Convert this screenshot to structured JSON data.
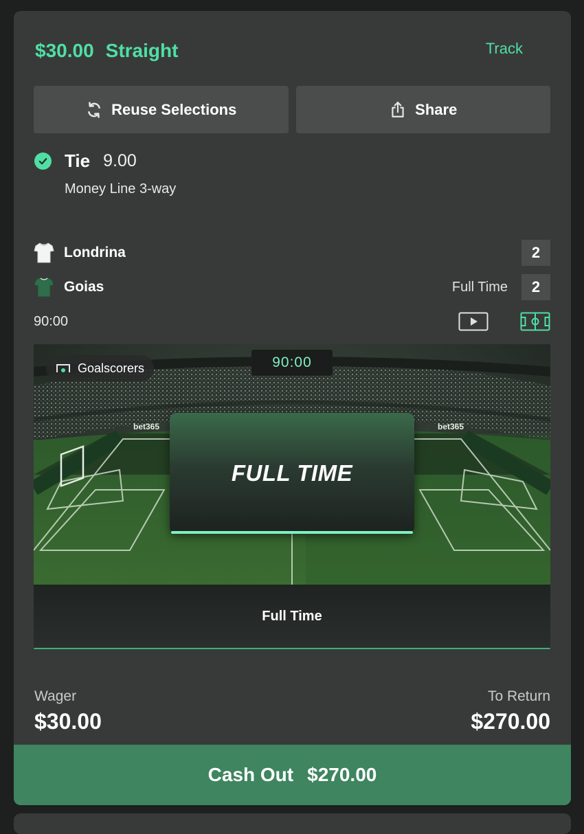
{
  "bet": {
    "stake": "$30.00",
    "type": "Straight",
    "track_label": "Track"
  },
  "actions": {
    "reuse_label": "Reuse Selections",
    "share_label": "Share"
  },
  "selection": {
    "name": "Tie",
    "odds": "9.00",
    "market": "Money Line 3-way",
    "status": "won"
  },
  "match": {
    "home": {
      "name": "Londrina",
      "score": "2"
    },
    "away": {
      "name": "Goias",
      "score": "2"
    },
    "status": "Full Time",
    "clock": "90:00"
  },
  "visualization": {
    "clock": "90:00",
    "goalscorers_label": "Goalscorers",
    "overlay_title": "FULL TIME",
    "banner_text": "Full Time",
    "ad_text": "bet365"
  },
  "summary": {
    "wager_label": "Wager",
    "wager_amount": "$30.00",
    "return_label": "To Return",
    "return_amount": "$270.00"
  },
  "cashout": {
    "label": "Cash Out",
    "amount": "$270.00"
  },
  "colors": {
    "accent": "#4fdfa5",
    "card_bg": "#383a39",
    "button_bg": "#4a4d4c",
    "cashout_bg": "#3e8560"
  }
}
